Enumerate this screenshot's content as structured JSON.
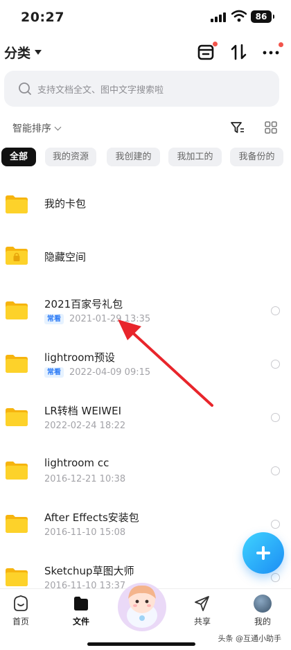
{
  "status_bar": {
    "time": "20:27",
    "battery": "86"
  },
  "header": {
    "title": "分类"
  },
  "search": {
    "placeholder": "支持文档全文、图中文字搜索啦"
  },
  "sort": {
    "label": "智能排序"
  },
  "chips": [
    "全部",
    "我的资源",
    "我创建的",
    "我加工的",
    "我备份的"
  ],
  "files": [
    {
      "name": "我的卡包",
      "badge": "",
      "meta": "",
      "locked": false,
      "selectable": false
    },
    {
      "name": "隐藏空间",
      "badge": "",
      "meta": "",
      "locked": true,
      "selectable": false
    },
    {
      "name": "2021百家号礼包",
      "badge": "常看",
      "meta": "2021-01-29 13:35",
      "locked": false,
      "selectable": true
    },
    {
      "name": "lightroom预设",
      "badge": "常看",
      "meta": "2022-04-09 09:15",
      "locked": false,
      "selectable": true
    },
    {
      "name": "LR转档   WEIWEI",
      "badge": "",
      "meta": "2022-02-24 18:22",
      "locked": false,
      "selectable": true
    },
    {
      "name": "lightroom cc",
      "badge": "",
      "meta": "2016-12-21 10:38",
      "locked": false,
      "selectable": true
    },
    {
      "name": "After Effects安装包",
      "badge": "",
      "meta": "2016-11-10 15:08",
      "locked": false,
      "selectable": true
    },
    {
      "name": "Sketchup草图大师",
      "badge": "",
      "meta": "2016-11-10 13:37",
      "locked": false,
      "selectable": true
    }
  ],
  "nav": {
    "home": "首页",
    "files": "文件",
    "share": "共享",
    "me": "我的"
  },
  "watermark": "头条 @互通小助手",
  "colors": {
    "accent": "#1c8df4",
    "folder": "#f9c51b",
    "notify_dot": "#f2544b",
    "arrow": "#e8252b"
  }
}
